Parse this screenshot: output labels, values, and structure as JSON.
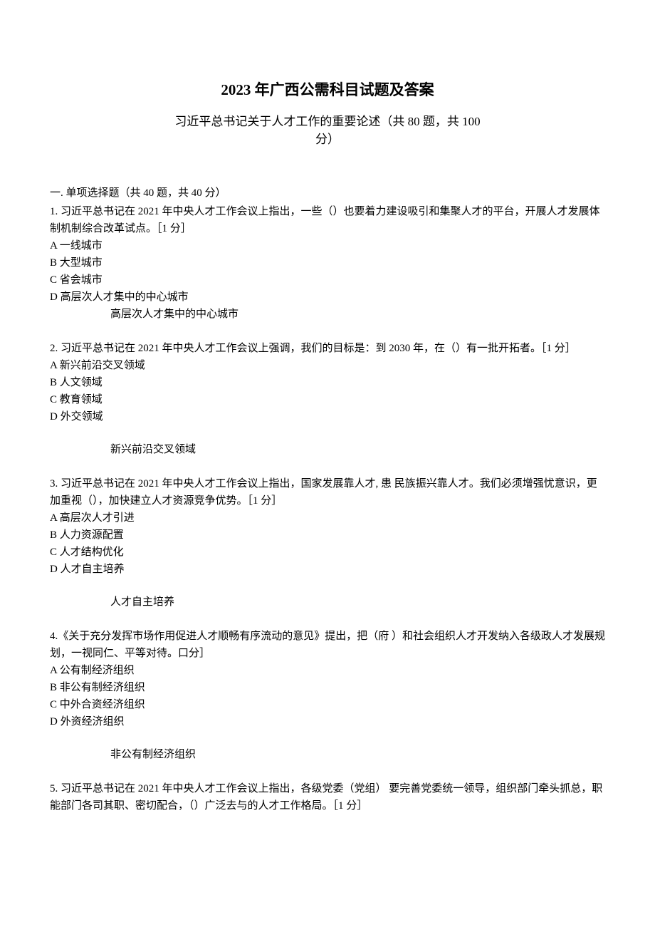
{
  "title": "2023 年广西公需科目试题及答案",
  "subtitle_line1": "习近平总书记关于人才工作的重要论述（共 80 题，共 100",
  "subtitle_line2": "分）",
  "section1_header": "一. 单项选择题（共 40 题，共 40 分）",
  "q1": {
    "text": "1. 习近平总书记在 2021 年中央人才工作会议上指出，一些（）也要着力建设吸引和集聚人才的平台，开展人才发展体制机制综合改革试点。［1 分］",
    "optA": "A 一线城市",
    "optB": "B 大型城市",
    "optC": "C 省会城市",
    "optD": "D 高层次人才集中的中心城市",
    "answer": "高层次人才集中的中心城市"
  },
  "q2": {
    "text": "2. 习近平总书记在 2021 年中央人才工作会议上强调，我们的目标是：到 2030 年，在（）有一批开拓者。［1 分］",
    "optA": "A 新兴前沿交叉领域",
    "optB": "B 人文领域",
    "optC": "C 教育领域",
    "optD": "D 外交领域",
    "answer": "新兴前沿交叉领域"
  },
  "q3": {
    "text": "3. 习近平总书记在 2021 年中央人才工作会议上指出，国家发展靠人才, 患   民族振兴靠人才。我们必须增强忧意识，更加重视（），加快建立人才资源竞争优势。［1 分］",
    "optA": "A 高层次人才引进",
    "optB": "B 人力资源配置",
    "optC": "C 人才结构优化",
    "optD": "D 人才自主培养",
    "answer": "人才自主培养"
  },
  "q4": {
    "text": "4.《关于充分发挥市场作用促进人才顺畅有序流动的意见》提出，把（府   ）和社会组织人才开发纳入各级政人才发展规划，一视同仁、平等对待。口分］",
    "optA": "A 公有制经济组织",
    "optB": "B 非公有制经济组织",
    "optC": "C 中外合资经济组织",
    "optD": "D 外资经济组织",
    "answer": "非公有制经济组织"
  },
  "q5": {
    "text": "5. 习近平总书记在 2021 年中央人才工作会议上指出，各级党委（党组）   要完善党委统一领导，组织部门牵头抓总，职能部门各司其职、密切配合，（）广泛去与的人才工作格局。［1 分］"
  }
}
